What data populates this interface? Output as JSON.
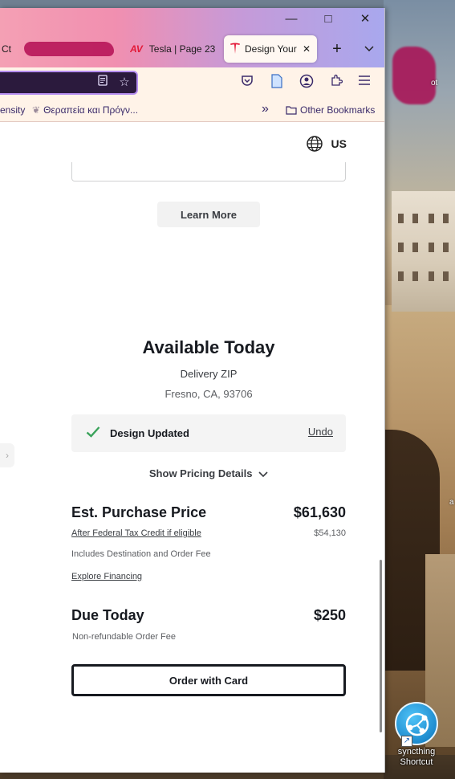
{
  "browser": {
    "tabs": [
      {
        "label": "Ct",
        "active": false
      },
      {
        "label": "Tesla | Page 23!",
        "active": false,
        "icon": "av-logo"
      },
      {
        "label": "Design Your",
        "active": true,
        "icon": "tesla-logo"
      }
    ],
    "new_tab_label": "+",
    "list_all_tabs": "⌄",
    "window_controls": {
      "minimize": "—",
      "maximize": "□",
      "close": "✕"
    },
    "bookmarks": [
      {
        "label": "ensity"
      },
      {
        "label": "Θεραπεία και Πρόγν..."
      }
    ],
    "bookmarks_overflow": "»",
    "other_bookmarks": "Other Bookmarks"
  },
  "page": {
    "region": "US",
    "learn_more": "Learn More",
    "available_title": "Available Today",
    "delivery_label": "Delivery ZIP",
    "delivery_location": "Fresno, CA, 93706",
    "design_updated": "Design Updated",
    "undo": "Undo",
    "show_pricing": "Show Pricing Details",
    "purchase_label": "Est. Purchase Price",
    "purchase_value": "$61,630",
    "tax_credit_link": "After Federal Tax Credit if eligible",
    "tax_credit_value": "$54,130",
    "includes_fee": "Includes Destination and Order Fee",
    "explore_financing": "Explore Financing",
    "due_label": "Due Today",
    "due_value": "$250",
    "non_refundable": "Non-refundable Order Fee",
    "order_button": "Order with Card",
    "side_tab": "›"
  },
  "desktop": {
    "edge_text_1": "ot",
    "edge_text_2": "a",
    "shortcut_label_1": "syncthing",
    "shortcut_label_2": "Shortcut",
    "shortcut_arrow": "↗"
  },
  "colors": {
    "tesla_red": "#e31937",
    "check_green": "#3aa35b",
    "text_dark": "#171a20"
  }
}
